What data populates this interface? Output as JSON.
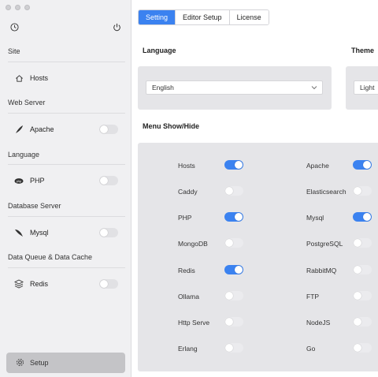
{
  "window": {
    "controls": [
      "close",
      "minimize",
      "zoom"
    ]
  },
  "sidebar": {
    "top_icons": {
      "left": "clock-icon",
      "right": "power-icon"
    },
    "sections": [
      {
        "title": "Site",
        "items": [
          {
            "label": "Hosts",
            "icon": "home-icon",
            "toggle": null
          }
        ]
      },
      {
        "title": "Web Server",
        "items": [
          {
            "label": "Apache",
            "icon": "feather-icon",
            "toggle": false
          }
        ]
      },
      {
        "title": "Language",
        "items": [
          {
            "label": "PHP",
            "icon": "php-icon",
            "toggle": false
          }
        ]
      },
      {
        "title": "Database Server",
        "items": [
          {
            "label": "Mysql",
            "icon": "dolphin-icon",
            "toggle": false
          }
        ]
      },
      {
        "title": "Data Queue & Data Cache",
        "items": [
          {
            "label": "Redis",
            "icon": "stack-icon",
            "toggle": false
          }
        ]
      }
    ],
    "setup_label": "Setup"
  },
  "tabs": [
    {
      "label": "Setting",
      "active": true
    },
    {
      "label": "Editor Setup",
      "active": false
    },
    {
      "label": "License",
      "active": false
    }
  ],
  "language": {
    "heading": "Language",
    "value": "English"
  },
  "theme": {
    "heading": "Theme",
    "value": "Light"
  },
  "menu": {
    "heading": "Menu Show/Hide",
    "left": [
      {
        "label": "Hosts",
        "on": true
      },
      {
        "label": "Caddy",
        "on": false
      },
      {
        "label": "PHP",
        "on": true
      },
      {
        "label": "MongoDB",
        "on": false
      },
      {
        "label": "Redis",
        "on": true
      },
      {
        "label": "Ollama",
        "on": false
      },
      {
        "label": "Http Serve",
        "on": false
      },
      {
        "label": "Erlang",
        "on": false
      }
    ],
    "right": [
      {
        "label": "Apache",
        "on": true
      },
      {
        "label": "Elasticsearch",
        "on": false
      },
      {
        "label": "Mysql",
        "on": true
      },
      {
        "label": "PostgreSQL",
        "on": false
      },
      {
        "label": "RabbitMQ",
        "on": false
      },
      {
        "label": "FTP",
        "on": false
      },
      {
        "label": "NodeJS",
        "on": false
      },
      {
        "label": "Go",
        "on": false
      }
    ]
  },
  "colors": {
    "accent": "#3b82f0",
    "sidebar_bg": "#f0f0f2",
    "panel_bg": "#e5e5e8"
  }
}
